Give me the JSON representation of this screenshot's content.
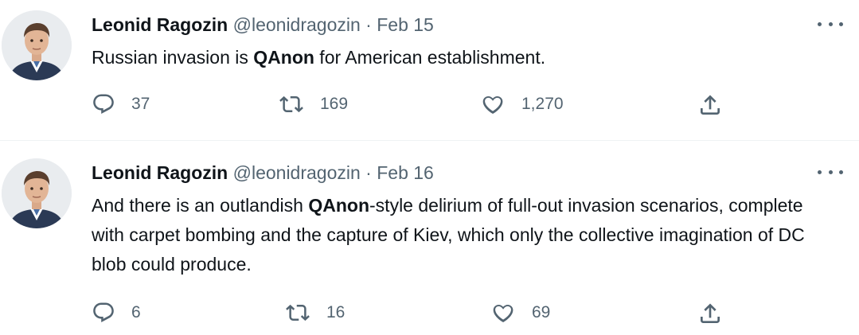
{
  "colors": {
    "text_primary": "#0f1419",
    "text_secondary": "#536471",
    "divider": "#eff3f4"
  },
  "tweets": [
    {
      "author_name": "Leonid Ragozin",
      "handle": "@leonidragozin",
      "separator": "·",
      "date": "Feb 15",
      "avatar_icon": "user-avatar-photo",
      "text_parts": [
        "Russian invasion is ",
        "QAnon",
        " for American establishment."
      ],
      "reply_count": "37",
      "retweet_count": "169",
      "like_count": "1,270"
    },
    {
      "author_name": "Leonid Ragozin",
      "handle": "@leonidragozin",
      "separator": "·",
      "date": "Feb 16",
      "avatar_icon": "user-avatar-photo",
      "text_parts": [
        "And there is an outlandish ",
        "QAnon",
        "-style delirium of full-out invasion scenarios, complete with carpet bombing and the capture of Kiev, which only the collective imagination of DC blob could produce."
      ],
      "reply_count": "6",
      "retweet_count": "16",
      "like_count": "69"
    }
  ],
  "icons": {
    "reply": "reply-icon",
    "retweet": "retweet-icon",
    "like": "heart-icon",
    "share": "share-icon",
    "more": "more-options-icon"
  }
}
